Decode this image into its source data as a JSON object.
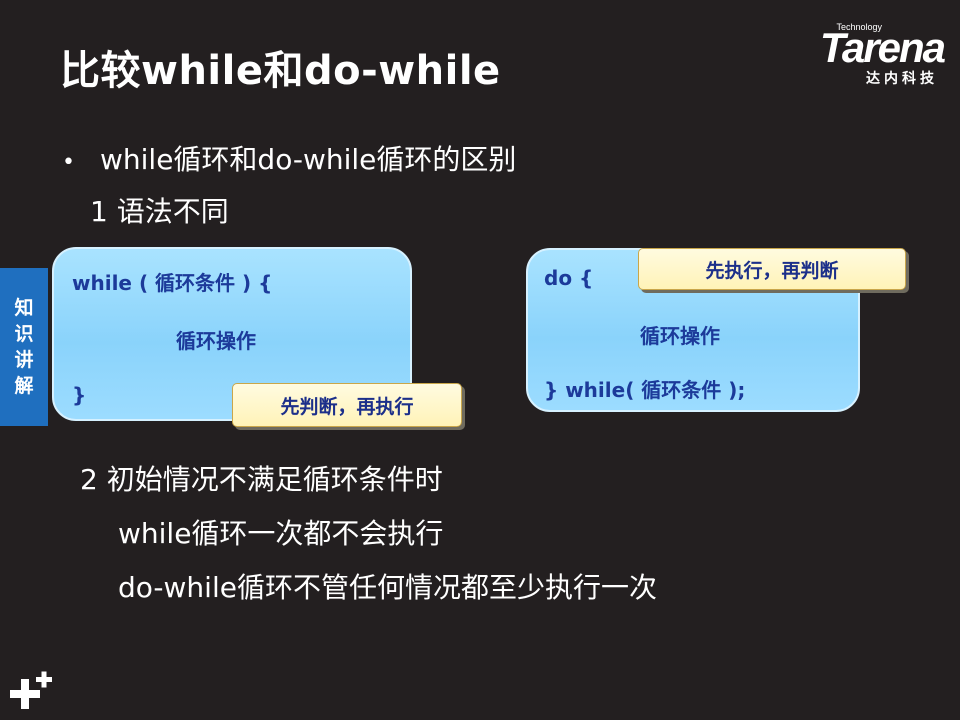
{
  "slide": {
    "title": "比较while和do-while",
    "logo": {
      "small_text": "Technology",
      "word": "Tarena",
      "chinese": "达内科技"
    },
    "side_tab": [
      "知",
      "识",
      "讲",
      "解"
    ],
    "bullet": {
      "symbol": "•",
      "text": "while循环和do-while循环的区别"
    },
    "step1": "1  语法不同",
    "while_box": {
      "line1": "while ( 循环条件 ) {",
      "line2": "循环操作",
      "line3": "}",
      "callout": "先判断，再执行"
    },
    "do_while_box": {
      "line1": "do {",
      "line2": "循环操作",
      "line3": "} while( 循环条件 );",
      "callout": "先执行，再判断"
    },
    "step2": "2  初始情况不满足循环条件时",
    "detail1": "while循环一次都不会执行",
    "detail2": "do-while循环不管任何情况都至少执行一次"
  },
  "colors": {
    "background": "#231f20",
    "code_box": "#9cdcff",
    "code_text": "#1c3a9a",
    "callout": "#fff3b8",
    "side_tab": "#1f6fbf"
  }
}
